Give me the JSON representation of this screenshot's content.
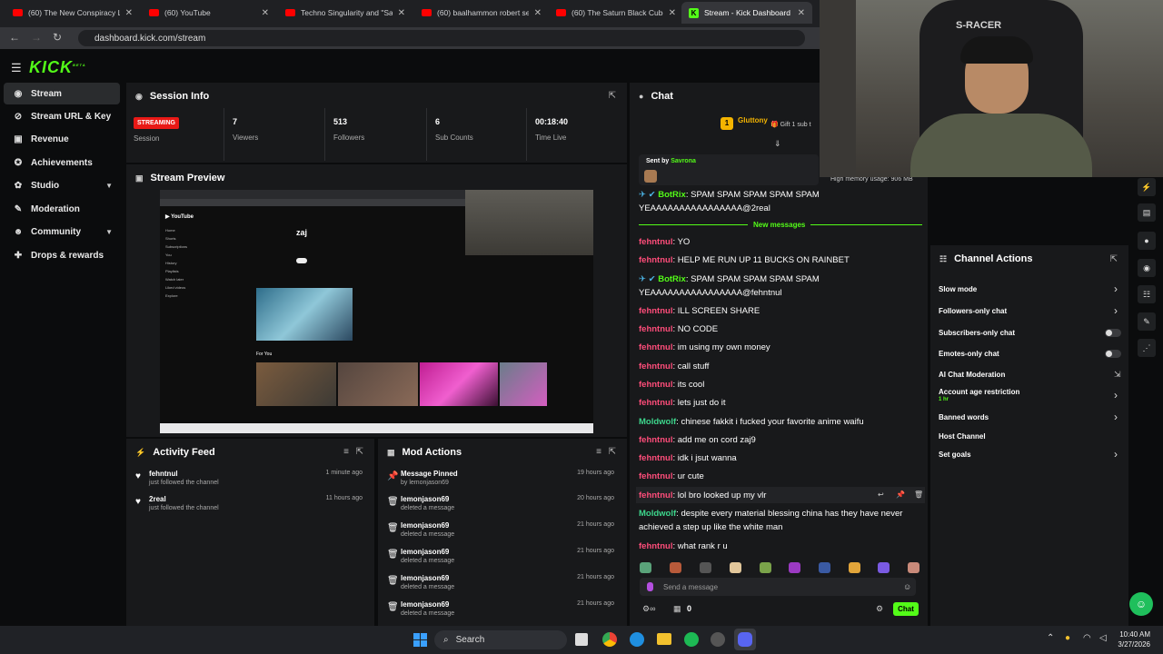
{
  "browser": {
    "tabs": [
      {
        "label": "(60) The New Conspiracy La",
        "kind": "youtube"
      },
      {
        "label": "(60) YouTube",
        "kind": "youtube"
      },
      {
        "label": "Techno Singularity and \"Sata",
        "kind": "youtube"
      },
      {
        "label": "(60) baalhammon robert sep",
        "kind": "youtube"
      },
      {
        "label": "(60) The Saturn Black Cube T",
        "kind": "youtube"
      },
      {
        "label": "Stream - Kick Dashboard",
        "kind": "kick"
      }
    ],
    "url": "dashboard.kick.com/stream"
  },
  "brand": {
    "logo": "KICK",
    "beta": "BETA"
  },
  "sidebar": {
    "items": [
      {
        "label": "Stream",
        "icon": "broadcast-icon"
      },
      {
        "label": "Stream URL & Key",
        "icon": "link-icon"
      },
      {
        "label": "Revenue",
        "icon": "wallet-icon"
      },
      {
        "label": "Achievements",
        "icon": "trophy-icon"
      },
      {
        "label": "Studio",
        "icon": "studio-icon"
      },
      {
        "label": "Moderation",
        "icon": "wrench-icon"
      },
      {
        "label": "Community",
        "icon": "people-icon"
      },
      {
        "label": "Drops & rewards",
        "icon": "gift-icon"
      }
    ]
  },
  "session": {
    "title": "Session Info",
    "status": "STREAMING",
    "status_label": "Session",
    "stats": [
      {
        "value": "7",
        "label": "Viewers"
      },
      {
        "value": "513",
        "label": "Followers"
      },
      {
        "value": "6",
        "label": "Sub Counts"
      },
      {
        "value": "00:18:40",
        "label": "Time Live"
      }
    ]
  },
  "preview": {
    "title": "Stream Preview",
    "channel_name": "zaj",
    "section": "For You",
    "sidebar_links": [
      "Home",
      "Shorts",
      "Subscriptions",
      "You",
      "History",
      "Playlists",
      "Watch later",
      "Liked videos",
      "Explore"
    ]
  },
  "activity": {
    "title": "Activity Feed",
    "items": [
      {
        "user": "fehntnul",
        "action": "just followed the channel",
        "time": "1 minute ago"
      },
      {
        "user": "2real",
        "action": "just followed the channel",
        "time": "11 hours ago"
      }
    ]
  },
  "mod": {
    "title": "Mod Actions",
    "items": [
      {
        "user": "Message Pinned",
        "action": "by lemonjason69",
        "time": "19 hours ago",
        "icon": "pin-icon"
      },
      {
        "user": "lemonjason69",
        "action": "deleted a message",
        "time": "20 hours ago",
        "icon": "trash-icon"
      },
      {
        "user": "lemonjason69",
        "action": "deleted a message",
        "time": "21 hours ago",
        "icon": "trash-icon"
      },
      {
        "user": "lemonjason69",
        "action": "deleted a message",
        "time": "21 hours ago",
        "icon": "trash-icon"
      },
      {
        "user": "lemonjason69",
        "action": "deleted a message",
        "time": "21 hours ago",
        "icon": "trash-icon"
      },
      {
        "user": "lemonjason69",
        "action": "deleted a message",
        "time": "21 hours ago",
        "icon": "trash-icon"
      }
    ]
  },
  "chat": {
    "title": "Chat",
    "pinned_user": "Gluttony",
    "pinned_gift": "Gift 1 sub t",
    "sent_by_label": "Sent by",
    "sent_by_user": "Savrona",
    "new_messages": "New messages",
    "messages": [
      {
        "user": "BotRix",
        "text": "SPAM SPAM SPAM SPAM SPAM YEAAAAAAAAAAAAAAAA@2real",
        "color": "b"
      },
      {
        "user": "fehntnul",
        "text": "YO",
        "color": "f"
      },
      {
        "user": "fehntnul",
        "text": "HELP ME RUN UP 11 BUCKS ON RAINBET",
        "color": "f"
      },
      {
        "user": "BotRix",
        "text": "SPAM SPAM SPAM SPAM SPAM YEAAAAAAAAAAAAAAAA@fehntnul",
        "color": "b"
      },
      {
        "user": "fehntnul",
        "text": "ILL SCREEN SHARE",
        "color": "f"
      },
      {
        "user": "fehntnul",
        "text": "NO CODE",
        "color": "f"
      },
      {
        "user": "fehntnul",
        "text": "im using my own money",
        "color": "f"
      },
      {
        "user": "fehntnul",
        "text": "call stuff",
        "color": "f"
      },
      {
        "user": "fehntnul",
        "text": "its cool",
        "color": "f"
      },
      {
        "user": "fehntnul",
        "text": "lets just do it",
        "color": "f"
      },
      {
        "user": "Moldwolf",
        "text": "chinese fakkit i fucked your favorite anime waifu",
        "color": "m"
      },
      {
        "user": "fehntnul",
        "text": "add me on cord zaj9",
        "color": "f"
      },
      {
        "user": "fehntnul",
        "text": "idk i jsut wanna",
        "color": "f"
      },
      {
        "user": "fehntnul",
        "text": "ur cute",
        "color": "f"
      },
      {
        "user": "fehntnul",
        "text": "lol bro looked up my vlr",
        "color": "f"
      },
      {
        "user": "Moldwolf",
        "text": "despite every material blessing china has they have never achieved a step up like the white man",
        "color": "m"
      },
      {
        "user": "fehntnul",
        "text": "what rank r u",
        "color": "f"
      }
    ],
    "input_placeholder": "Send a message",
    "count": "0",
    "send_label": "Chat"
  },
  "channel_actions": {
    "title": "Channel Actions",
    "items": [
      {
        "label": "Slow mode",
        "control": "arrow"
      },
      {
        "label": "Followers-only chat",
        "control": "arrow"
      },
      {
        "label": "Subscribers-only chat",
        "control": "toggle"
      },
      {
        "label": "Emotes-only chat",
        "control": "toggle"
      },
      {
        "label": "AI Chat Moderation",
        "control": "external"
      },
      {
        "label": "Account age restriction",
        "sub": "1 hr",
        "control": "arrow"
      },
      {
        "label": "Banned words",
        "control": "arrow"
      },
      {
        "label": "Host Channel",
        "control": "none"
      },
      {
        "label": "Set goals",
        "control": "arrow"
      }
    ]
  },
  "overlay": {
    "memory_warning": "High memory usage: 906 MB",
    "chair_brand": "S-RACER"
  },
  "taskbar": {
    "search": "Search",
    "time": "10:40 AM",
    "date": "3/27/2026"
  },
  "colors": {
    "accent": "#53fc18",
    "live": "#e91916",
    "panel": "#18191b"
  }
}
